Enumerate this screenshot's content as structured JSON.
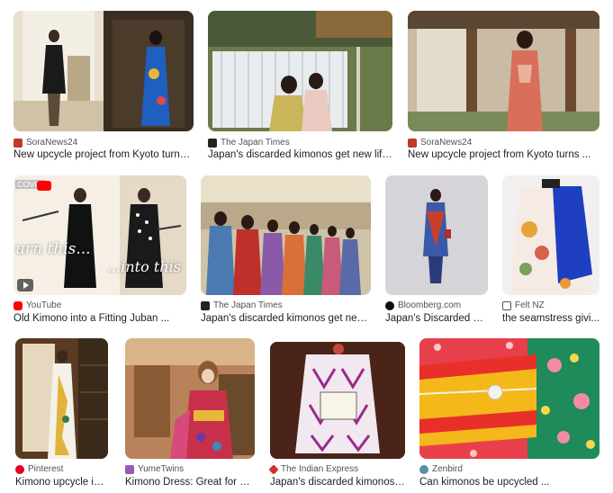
{
  "results": [
    {
      "source": "SoraNews24",
      "title": "New upcycle project from Kyoto turns ...",
      "favicon": "soranews-icon",
      "color": "#c0392b"
    },
    {
      "source": "The Japan Times",
      "title": "Japan's discarded kimonos get new life ...",
      "favicon": "japantimes-icon",
      "color": "#222222"
    },
    {
      "source": "SoraNews24",
      "title": "New upcycle project from Kyoto turns ...",
      "favicon": "soranews-icon",
      "color": "#c0392b"
    },
    {
      "source": "YouTube",
      "title": "Old Kimono into a Fitting Juban ...",
      "favicon": "youtube-icon",
      "color": "#ff0000",
      "overlay_left": "urn this...",
      "overlay_right": "...into this",
      "badge": "COVID"
    },
    {
      "source": "The Japan Times",
      "title": "Japan's discarded kimonos get new l...",
      "favicon": "japantimes-icon",
      "color": "#222222"
    },
    {
      "source": "Bloomberg.com",
      "title": "Japan's Discarded Ki...",
      "favicon": "bloomberg-icon",
      "color": "#111111"
    },
    {
      "source": "Felt NZ",
      "title": "the seamstress givi...",
      "favicon": "felt-icon",
      "color": "#555555"
    },
    {
      "source": "Pinterest",
      "title": "Kimono upcycle ide...",
      "favicon": "pinterest-icon",
      "color": "#e60023"
    },
    {
      "source": "YumeTwins",
      "title": "Kimono Dress: Great for Up...",
      "favicon": "yumetwins-icon",
      "color": "#9b59b6"
    },
    {
      "source": "The Indian Express",
      "title": "Japan's discarded kimonos ...",
      "favicon": "indianexpress-icon",
      "color": "#d32f2f"
    },
    {
      "source": "Zenbird",
      "title": "Can kimonos be upcycled ...",
      "favicon": "zenbird-icon",
      "color": "#5a8fa8"
    }
  ]
}
